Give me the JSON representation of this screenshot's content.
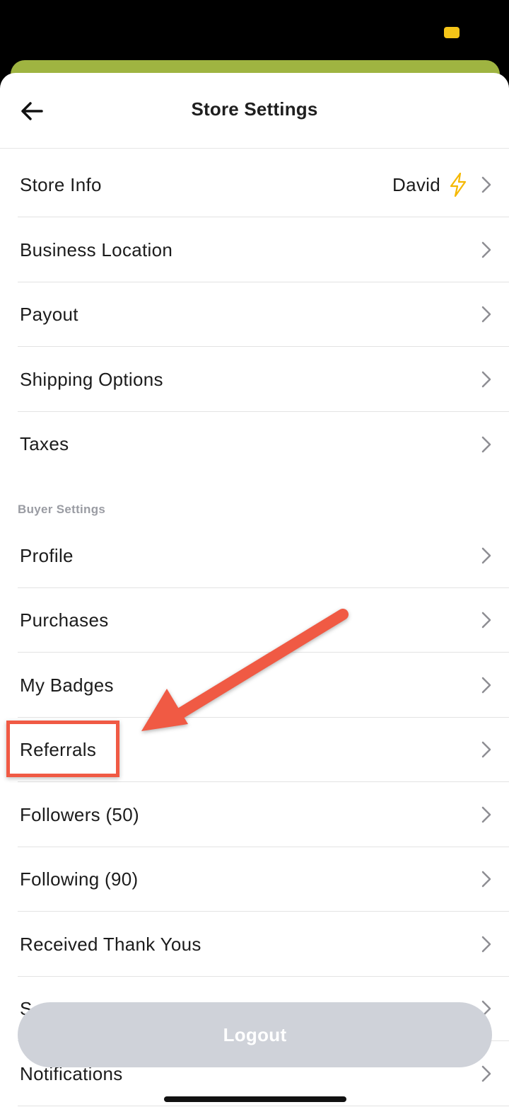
{
  "header": {
    "title": "Store Settings"
  },
  "store_rows": [
    {
      "label": "Store Info",
      "value": "David"
    },
    {
      "label": "Business Location"
    },
    {
      "label": "Payout"
    },
    {
      "label": "Shipping Options"
    },
    {
      "label": "Taxes"
    }
  ],
  "buyer_section_label": "Buyer Settings",
  "buyer_rows": [
    {
      "label": "Profile"
    },
    {
      "label": "Purchases"
    },
    {
      "label": "My Badges"
    },
    {
      "label": "Referrals"
    },
    {
      "label": "Followers (50)"
    },
    {
      "label": "Following (90)"
    },
    {
      "label": "Received Thank Yous"
    },
    {
      "label": "S"
    },
    {
      "label": "Notifications"
    }
  ],
  "logout_label": "Logout",
  "colors": {
    "accent_green": "#9fb441",
    "annotation_red": "#f05a44",
    "bolt_yellow": "#f5b800",
    "logout_gray": "#cfd2d9"
  }
}
